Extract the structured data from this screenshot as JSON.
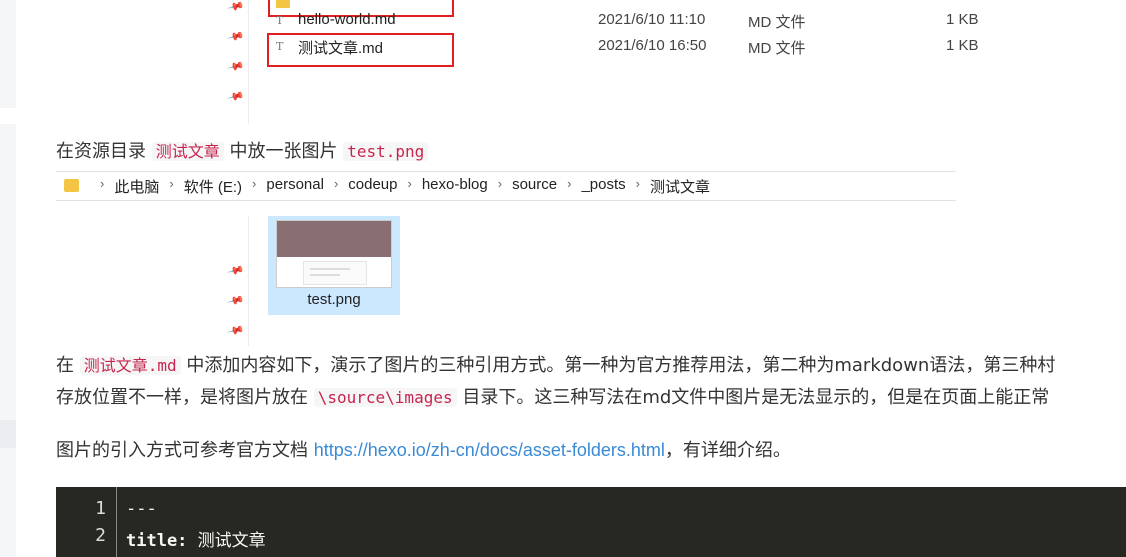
{
  "explorer_top": {
    "files": [
      {
        "name": "hello-world.md",
        "date": "2021/6/10 11:10",
        "type": "MD 文件",
        "size": "1 KB"
      },
      {
        "name": "测试文章.md",
        "date": "2021/6/10 16:50",
        "type": "MD 文件",
        "size": "1 KB"
      }
    ]
  },
  "para1": {
    "prefix": "在资源目录",
    "code1": "测试文章",
    "middle": "中放一张图片",
    "code2": "test.png"
  },
  "breadcrumb": [
    "此电脑",
    "软件 (E:)",
    "personal",
    "codeup",
    "hexo-blog",
    "source",
    "_posts",
    "测试文章"
  ],
  "thumbnail": {
    "label": "test.png"
  },
  "para2": {
    "line1_prefix": "在",
    "line1_code": "测试文章.md",
    "line1_text": "中添加内容如下，演示了图片的三种引用方式。第一种为官方推荐用法，第二种为markdown语法，第三种村",
    "line2_prefix": "存放位置不一样，是将图片放在",
    "line2_code": "\\source\\images",
    "line2_text": "目录下。这三种写法在md文件中图片是无法显示的，但是在页面上能正常"
  },
  "para3": {
    "prefix": "图片的引入方式可参考官方文档",
    "link": "https://hexo.io/zh-cn/docs/asset-folders.html",
    "suffix": "，有详细介绍。"
  },
  "code": {
    "lines": [
      {
        "num": "1",
        "text": "---"
      },
      {
        "num": "2",
        "key": "title:",
        "value": " 测试文章"
      }
    ]
  }
}
